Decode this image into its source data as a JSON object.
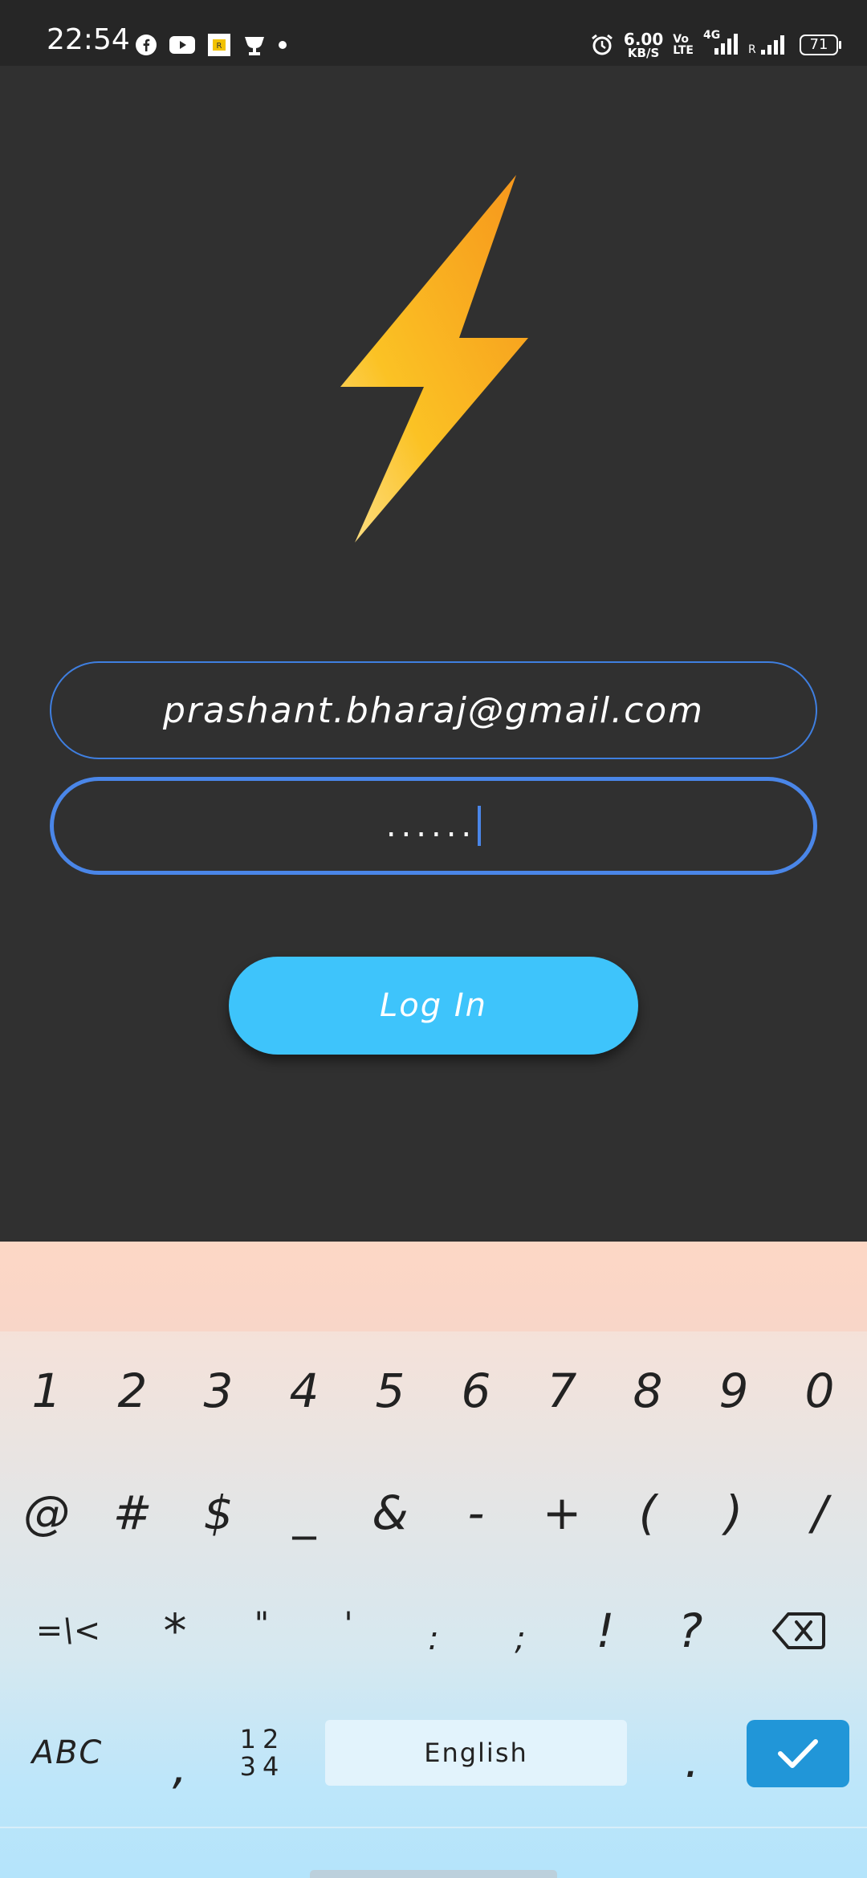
{
  "status_bar": {
    "time": "22:54",
    "net_speed_value": "6.00",
    "net_speed_unit": "KB/S",
    "volte_line1": "Vo",
    "volte_line2": "LTE",
    "network_label": "4G",
    "roaming_label": "R",
    "battery": "71",
    "icons": [
      "facebook-icon",
      "youtube-icon",
      "app-notification-icon",
      "trophy-icon",
      "dot-icon",
      "alarm-icon",
      "signal-icon",
      "signal-icon"
    ]
  },
  "login": {
    "logo": "lightning-bolt-icon",
    "email_value": "prashant.bharaj@gmail.com",
    "password_value": "......",
    "login_label": "Log In"
  },
  "colors": {
    "background": "#303030",
    "field_border": "#4a86e8",
    "button": "#3ec4fb",
    "bolt_start": "#fdd97a",
    "bolt_end": "#f7a21b"
  },
  "keyboard": {
    "row1": [
      "1",
      "2",
      "3",
      "4",
      "5",
      "6",
      "7",
      "8",
      "9",
      "0"
    ],
    "row2": [
      "@",
      "#",
      "$",
      "_",
      "&",
      "-",
      "+",
      "(",
      ")",
      "/"
    ],
    "row3": [
      "=\\<",
      "*",
      "\"",
      "'",
      ":",
      ";",
      "!",
      "?"
    ],
    "abc_label": "ABC",
    "comma_label": ",",
    "numbers_label_top": "12",
    "numbers_label_bottom": "34",
    "space_label": "English",
    "period_label": "."
  }
}
